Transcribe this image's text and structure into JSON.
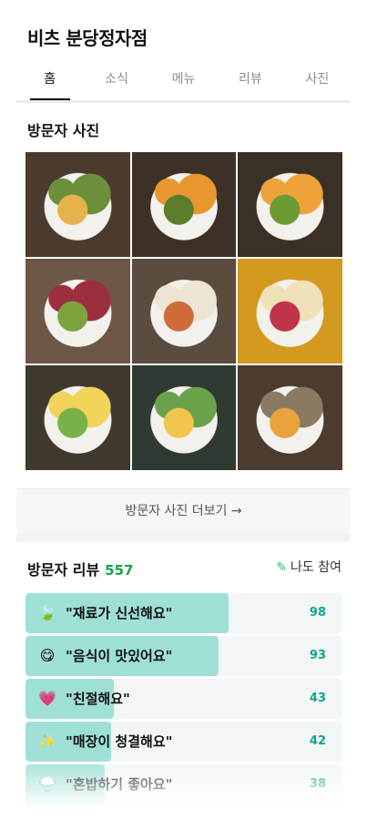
{
  "header": {
    "title": "비츠 분당정자점"
  },
  "tabs": [
    {
      "label": "홈",
      "active": true
    },
    {
      "label": "소식",
      "active": false
    },
    {
      "label": "메뉴",
      "active": false
    },
    {
      "label": "리뷰",
      "active": false
    },
    {
      "label": "사진",
      "active": false
    }
  ],
  "photos": {
    "section_title": "방문자 사진",
    "more_label": "방문자 사진 더보기 →",
    "items": [
      {
        "icon": "salad-bowl-photo",
        "colors": [
          "#4a3b2e",
          "#6b8f3a",
          "#e6b24c"
        ]
      },
      {
        "icon": "pumpkin-bowl-photo",
        "colors": [
          "#3d3127",
          "#e8962f",
          "#5b7d2b"
        ]
      },
      {
        "icon": "pumpkin-bowl-photo",
        "colors": [
          "#3a3026",
          "#f0a23a",
          "#6c9a34"
        ]
      },
      {
        "icon": "mushroom-bowl-photo",
        "colors": [
          "#6e5747",
          "#9c2f3f",
          "#7da33e"
        ]
      },
      {
        "icon": "sushi-plate-photo",
        "colors": [
          "#5a4c3f",
          "#ede4d3",
          "#cf6b3a"
        ]
      },
      {
        "icon": "tray-photo",
        "colors": [
          "#d39a1f",
          "#f1e1b8",
          "#c0344a"
        ]
      },
      {
        "icon": "noodle-salad-photo",
        "colors": [
          "#3f3a2d",
          "#f2d45a",
          "#7ab04a"
        ]
      },
      {
        "icon": "avocado-bowl-photo",
        "colors": [
          "#2f3a33",
          "#6aa24c",
          "#f0c64e"
        ]
      },
      {
        "icon": "grain-bowl-photo",
        "colors": [
          "#4b3c2f",
          "#8a7a61",
          "#e8a33a"
        ]
      }
    ]
  },
  "reviews": {
    "title": "방문자 리뷰",
    "count": "557",
    "join_label": "나도 참여",
    "items": [
      {
        "icon": "leaf-icon",
        "glyph": "🍃",
        "label": "\"재료가 신선해요\"",
        "count": "98",
        "fill": 0.64
      },
      {
        "icon": "yum-face-icon",
        "glyph": "😋",
        "label": "\"음식이 맛있어요\"",
        "count": "93",
        "fill": 0.61
      },
      {
        "icon": "heart-icon",
        "glyph": "💗",
        "label": "\"친절해요\"",
        "count": "43",
        "fill": 0.28
      },
      {
        "icon": "sparkles-icon",
        "glyph": "✨",
        "label": "\"매장이 청결해요\"",
        "count": "42",
        "fill": 0.27
      },
      {
        "icon": "rice-bowl-icon",
        "glyph": "🍚",
        "label": "\"혼밥하기 좋아요\"",
        "count": "38",
        "fill": 0.25
      }
    ]
  }
}
